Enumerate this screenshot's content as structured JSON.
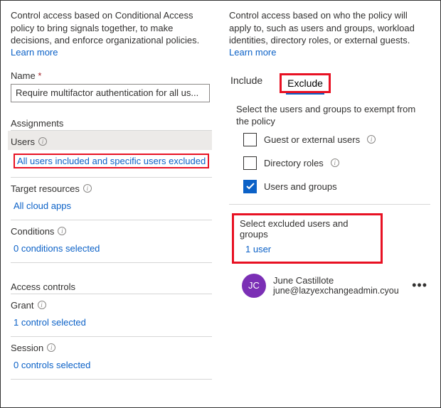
{
  "left": {
    "intro": "Control access based on Conditional Access policy to bring signals together, to make decisions, and enforce organizational policies.",
    "learn_more": "Learn more",
    "name_label": "Name",
    "name_value": "Require multifactor authentication for all us...",
    "assignments_heading": "Assignments",
    "users": {
      "label": "Users",
      "value": "All users included and specific users excluded"
    },
    "target": {
      "label": "Target resources",
      "value": "All cloud apps"
    },
    "conditions": {
      "label": "Conditions",
      "value": "0 conditions selected"
    },
    "access_controls_heading": "Access controls",
    "grant": {
      "label": "Grant",
      "value": "1 control selected"
    },
    "session": {
      "label": "Session",
      "value": "0 controls selected"
    }
  },
  "right": {
    "intro": "Control access based on who the policy will apply to, such as users and groups, workload identities, directory roles, or external guests.",
    "learn_more": "Learn more",
    "tabs": {
      "include": "Include",
      "exclude": "Exclude"
    },
    "sub_intro": "Select the users and groups to exempt from the policy",
    "opts": {
      "guest": "Guest or external users",
      "roles": "Directory roles",
      "usersgroups": "Users and groups"
    },
    "select_block": {
      "label": "Select excluded users and groups",
      "value": "1 user"
    },
    "user": {
      "initials": "JC",
      "name": "June Castillote",
      "email": "june@lazyexchangeadmin.cyou"
    }
  }
}
